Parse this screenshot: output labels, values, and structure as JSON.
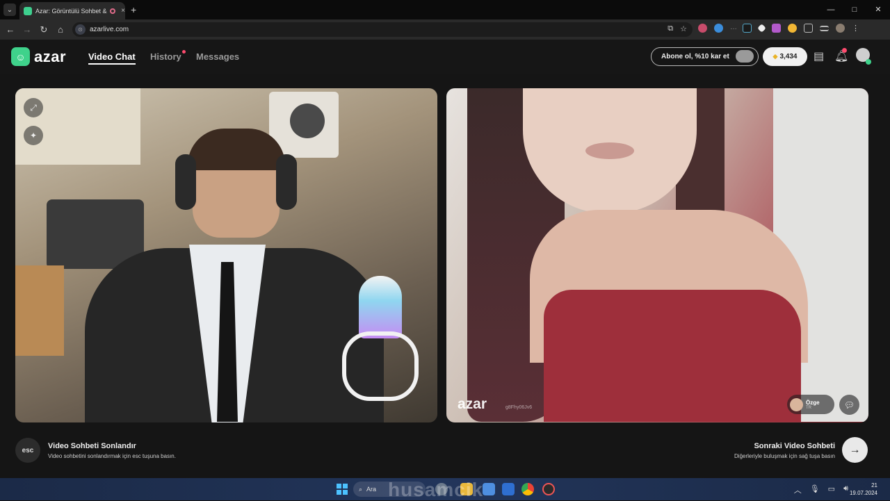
{
  "browser": {
    "tab_title": "Azar: Görüntülü Sohbet & V",
    "url": "azarlive.com",
    "new_tab": "+",
    "tab_close": "×",
    "win_controls": [
      "—",
      "□",
      "✕"
    ]
  },
  "app": {
    "logo_text": "azar",
    "nav": [
      {
        "label": "Video Chat",
        "active": true
      },
      {
        "label": "History",
        "has_dot": true
      },
      {
        "label": "Messages"
      }
    ],
    "subscribe_label": "Abone ol, %10 kar et",
    "gems_count": "3,434",
    "notifications_badge": true
  },
  "video": {
    "watermark": "azar",
    "watermark_id": "g8Fhy06Jv6",
    "peer": {
      "name": "Özge",
      "country": "TR"
    }
  },
  "controls": {
    "esc_key": "esc",
    "end_title": "Video Sohbeti Sonlandır",
    "end_sub": "Video sohbetini sonlandırmak için esc tuşuna basın.",
    "next_title": "Sonraki Video Sohbeti",
    "next_sub": "Diğerleriyle buluşmak için sağ tuşa basın",
    "next_icon": "→"
  },
  "taskbar": {
    "search_label": "Ara",
    "clock_time": "21",
    "clock_date": "19.07.2024",
    "overlay": "husamcik"
  },
  "colors": {
    "accent_green": "#3fd28b",
    "badge_red": "#ff4b6e",
    "gem_gold": "#e9b326",
    "background": "#151515"
  }
}
